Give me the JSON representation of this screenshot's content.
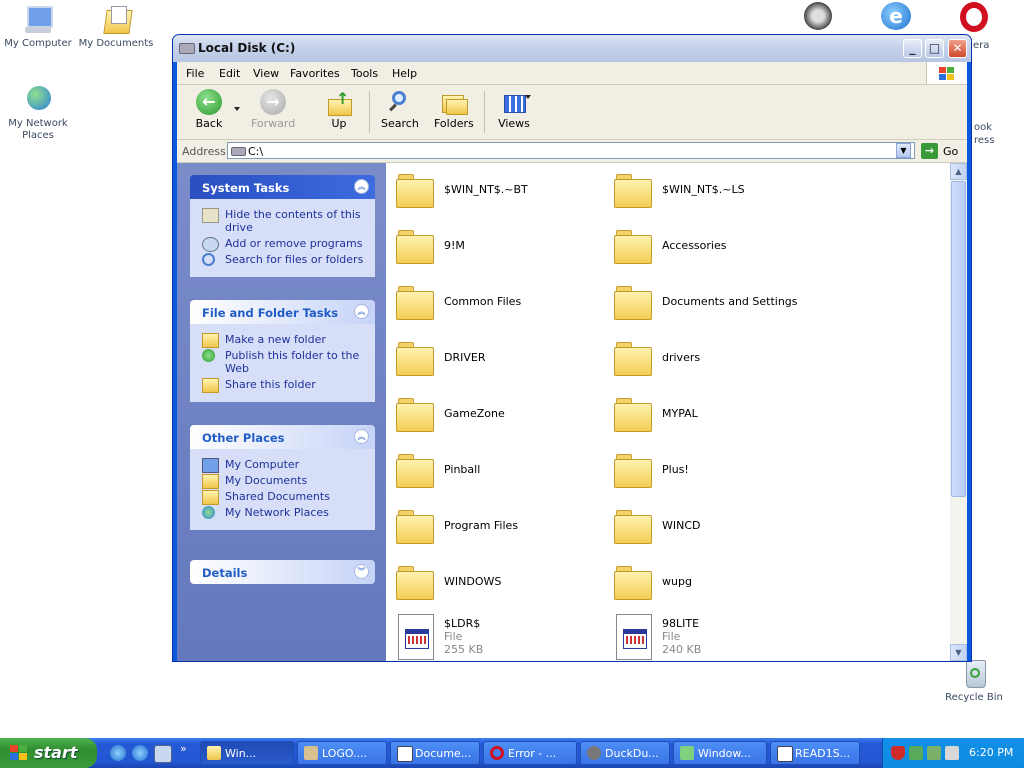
{
  "desktop": {
    "icons": [
      {
        "label": "My Computer"
      },
      {
        "label": "My Documents"
      },
      {
        "label": "My Network Places"
      },
      {
        "label": "Recycle Bin"
      }
    ],
    "right_labels": [
      "era",
      "ook",
      "ress"
    ]
  },
  "window": {
    "title": "Local Disk (C:)",
    "menu": [
      "File",
      "Edit",
      "View",
      "Favorites",
      "Tools",
      "Help"
    ],
    "toolbar": {
      "back": "Back",
      "forward": "Forward",
      "up": "Up",
      "search": "Search",
      "folders": "Folders",
      "views": "Views"
    },
    "address": {
      "label": "Address",
      "value": "C:\\",
      "go": "Go"
    }
  },
  "taskpane": {
    "system_tasks": {
      "title": "System Tasks",
      "items": [
        "Hide the contents of this drive",
        "Add or remove programs",
        "Search for files or folders"
      ]
    },
    "file_folder_tasks": {
      "title": "File and Folder Tasks",
      "items": [
        "Make a new folder",
        "Publish this folder to the Web",
        "Share this folder"
      ]
    },
    "other_places": {
      "title": "Other Places",
      "items": [
        "My Computer",
        "My Documents",
        "Shared Documents",
        "My Network Places"
      ]
    },
    "details": {
      "title": "Details"
    }
  },
  "files": {
    "folders": [
      "$WIN_NT$.~BT",
      "$WIN_NT$.~LS",
      "9!M",
      "Accessories",
      "Common Files",
      "Documents and Settings",
      "DRIVER",
      "drivers",
      "GameZone",
      "MYPAL",
      "Pinball",
      "Plus!",
      "Program Files",
      "WINCD",
      "WINDOWS",
      "wupg"
    ],
    "docs": [
      {
        "name": "$LDR$",
        "type": "File",
        "size": "255 KB"
      },
      {
        "name": "98LITE",
        "type": "File",
        "size": "240 KB"
      }
    ]
  },
  "taskbar": {
    "start": "start",
    "buttons": [
      "Win...",
      "LOGO....",
      "Docume...",
      "Error - ...",
      "DuckDu...",
      "Window...",
      "READ1S..."
    ],
    "clock": "6:20 PM"
  }
}
